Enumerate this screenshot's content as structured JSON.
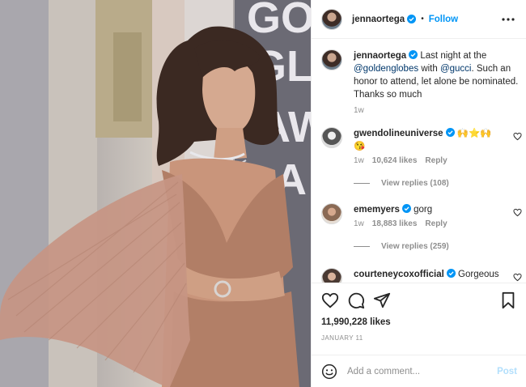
{
  "post": {
    "author": "jennaortega",
    "follow_label": "Follow",
    "caption_author": "jennaortega",
    "caption_part1": "Last night at the",
    "caption_mention1": "@goldenglobes",
    "caption_part2": "with",
    "caption_mention2": "@gucci",
    "caption_part3": ". Such an honor to attend, let alone be nominated. Thanks so much",
    "caption_time": "1w"
  },
  "comments": [
    {
      "user": "gwendolineuniverse",
      "text": "🙌⭐🙌 😘",
      "time": "1w",
      "likes": "10,624 likes",
      "reply": "Reply",
      "view_replies": "View replies (108)"
    },
    {
      "user": "ememyers",
      "text": "gorg",
      "time": "1w",
      "likes": "18,883 likes",
      "reply": "Reply",
      "view_replies": "View replies (259)"
    },
    {
      "user": "courteneycoxofficial",
      "text": "Gorgeous"
    }
  ],
  "footer": {
    "likes": "11,990,228 likes",
    "date": "JANUARY 11",
    "comment_placeholder": "Add a comment...",
    "post_label": "Post"
  },
  "colors": {
    "accent": "#0095f6",
    "mention": "#00376b",
    "post_disabled": "#b2dffc"
  },
  "icons": [
    "verified-badge-icon",
    "more-options-icon",
    "heart-icon",
    "comment-icon",
    "share-icon",
    "bookmark-icon",
    "emoji-icon"
  ]
}
